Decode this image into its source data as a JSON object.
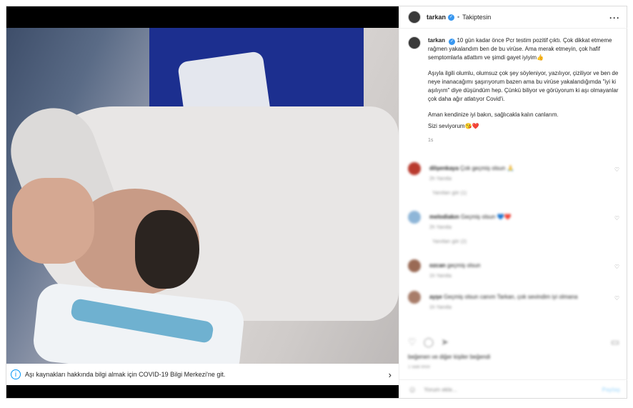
{
  "post": {
    "username": "tarkan",
    "follow_status": "Takiptesin",
    "more_icon": "more-dots-icon"
  },
  "caption": {
    "username": "tarkan",
    "p1": "10 gün kadar önce Pcr testim pozitif çıktı. Çok dikkat etmeme rağmen yakalandım ben de bu virüse. Ama merak etmeyin, çok hafif semptomlarla atlattım ve şimdi gayet iyiyim👍",
    "p2": "Aşıyla ilgili olumlu, olumsuz çok şey söyleniyor, yazılıyor, çiziliyor ve ben de neye inanacağımı şaşırıyorum bazen ama bu virüse yakalandığımda \"iyi ki aşılıyım\" diye düşündüm hep. Çünkü biliyor ve görüyorum ki aşı olmayanlar çok daha ağır atlatıyor Covid'i.",
    "p3a": "Aman kendinize iyi bakın, sağlıcakla kalın canlarım.",
    "p3b": "Sizi seviyorum😘❤️",
    "time": "1s"
  },
  "info_bar": {
    "text": "Aşı kaynakları hakkında bilgi almak için COVID-19 Bilgi Merkezi'ne git."
  },
  "comments": [
    {
      "user": "dilşenkaya",
      "text": "Çok geçmiş olsun 🙏",
      "meta": "2h  Yanıtla",
      "more": "Yanıtları gör (1)"
    },
    {
      "user": "melodiakın",
      "text": "Geçmiş olsun 💙❤️",
      "meta": "2h  Yanıtla",
      "more": "Yanıtları gör (2)"
    },
    {
      "user": "ozcan",
      "text": "geçmiş olsun",
      "meta": "1h  Yanıtla",
      "more": ""
    },
    {
      "user": "ayşe",
      "text": "Geçmiş olsun canım Tarkan, çok sevindim iyi olmana",
      "meta": "1h  Yanıtla",
      "more": ""
    }
  ],
  "likes": {
    "text": "beğenen ve diğer kişiler beğendi",
    "time": "1 saat önce"
  },
  "add_comment": {
    "placeholder": "Yorum ekle...",
    "post_label": "Paylaş"
  }
}
